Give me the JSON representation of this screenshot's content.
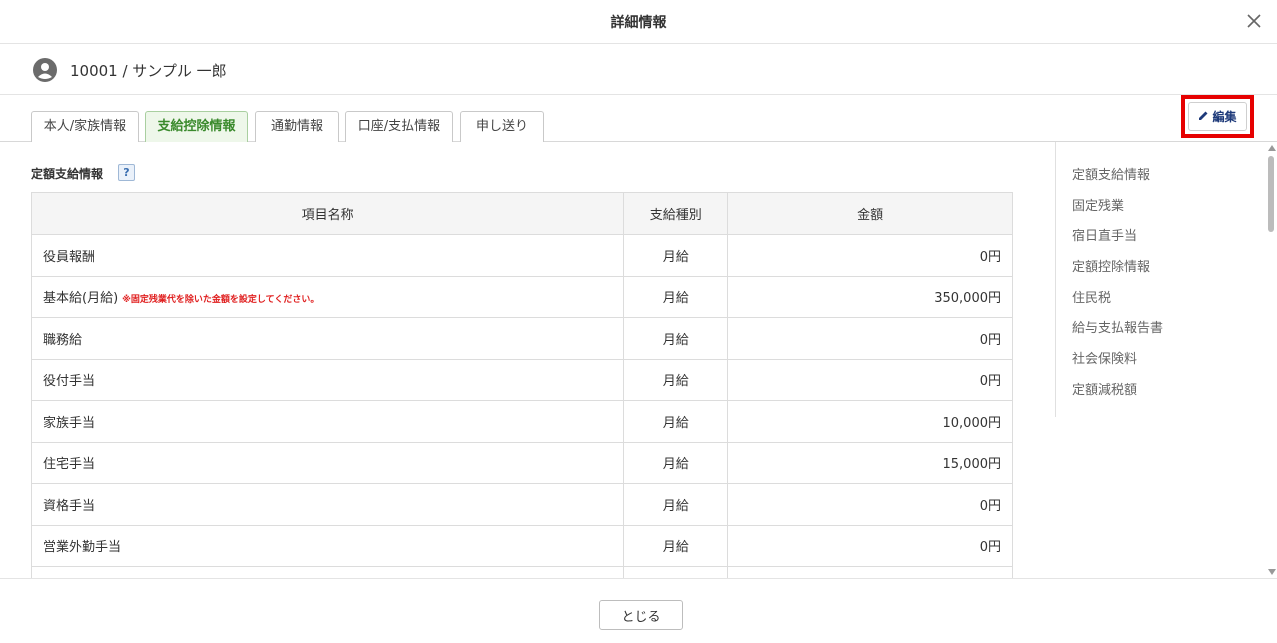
{
  "dialog": {
    "title": "詳細情報"
  },
  "user": {
    "label": "10001 / サンプル 一郎"
  },
  "tabs": [
    {
      "label": "本人/家族情報"
    },
    {
      "label": "支給控除情報"
    },
    {
      "label": "通勤情報"
    },
    {
      "label": "口座/支払情報"
    },
    {
      "label": "申し送り"
    }
  ],
  "active_tab": "支給控除情報",
  "edit_button": {
    "label": "編集"
  },
  "section": {
    "title": "定額支給情報",
    "help": "?"
  },
  "table": {
    "headers": [
      "項目名称",
      "支給種別",
      "金額"
    ],
    "rows": [
      {
        "name": "役員報酬",
        "note": "",
        "type": "月給",
        "amount": "0円"
      },
      {
        "name": "基本給(月給)",
        "note": "※固定残業代を除いた金額を設定してください。",
        "type": "月給",
        "amount": "350,000円"
      },
      {
        "name": "職務給",
        "note": "",
        "type": "月給",
        "amount": "0円"
      },
      {
        "name": "役付手当",
        "note": "",
        "type": "月給",
        "amount": "0円"
      },
      {
        "name": "家族手当",
        "note": "",
        "type": "月給",
        "amount": "10,000円"
      },
      {
        "name": "住宅手当",
        "note": "",
        "type": "月給",
        "amount": "15,000円"
      },
      {
        "name": "資格手当",
        "note": "",
        "type": "月給",
        "amount": "0円"
      },
      {
        "name": "営業外勤手当",
        "note": "",
        "type": "月給",
        "amount": "0円"
      }
    ]
  },
  "side_nav": [
    {
      "label": "定額支給情報"
    },
    {
      "label": "固定残業"
    },
    {
      "label": "宿日直手当"
    },
    {
      "label": "定額控除情報"
    },
    {
      "label": "住民税"
    },
    {
      "label": "給与支払報告書"
    },
    {
      "label": "社会保険料"
    },
    {
      "label": "定額減税額"
    }
  ],
  "footer": {
    "close_label": "とじる"
  },
  "colors": {
    "active_tab_text": "#3a8a2c",
    "highlight_border": "#e60000",
    "note_text": "#e02020",
    "edit_text": "#1e3a7a"
  }
}
